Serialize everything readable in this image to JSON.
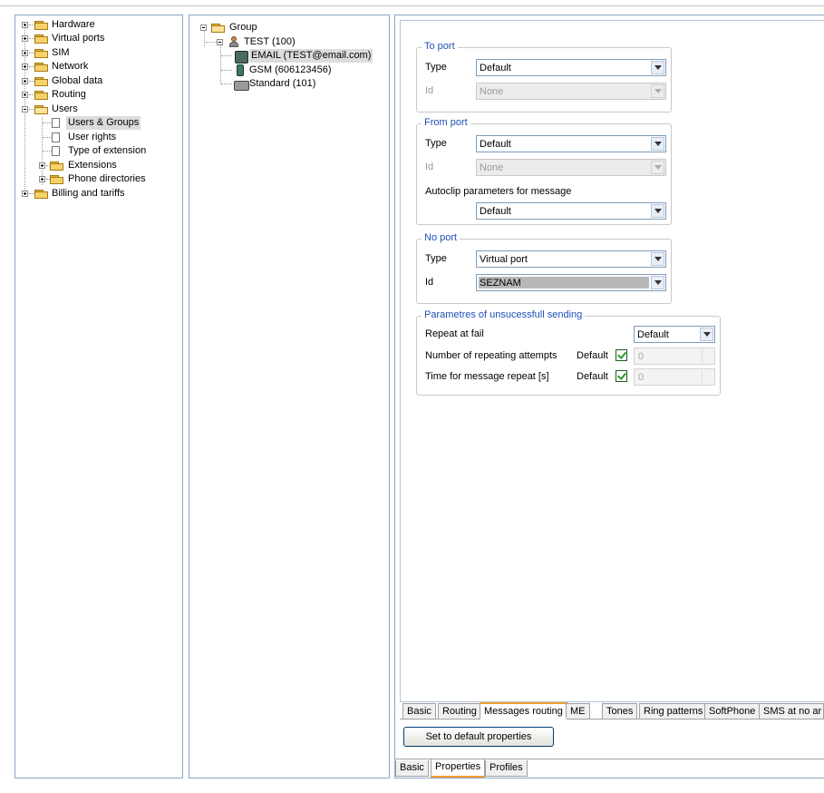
{
  "nav_tree": {
    "items": [
      {
        "label": "Hardware"
      },
      {
        "label": "Virtual ports"
      },
      {
        "label": "SIM"
      },
      {
        "label": "Network"
      },
      {
        "label": "Global data"
      },
      {
        "label": "Routing"
      },
      {
        "label": "Users"
      },
      {
        "label": "Users & Groups"
      },
      {
        "label": "User rights"
      },
      {
        "label": "Type of extension"
      },
      {
        "label": "Extensions"
      },
      {
        "label": "Phone directories"
      },
      {
        "label": "Billing and tariffs"
      }
    ]
  },
  "group_tree": {
    "root": "Group",
    "user": "TEST (100)",
    "email": "EMAIL (TEST@email.com)",
    "gsm": "GSM (606123456)",
    "standard": "Standard (101)"
  },
  "to_port": {
    "title": "To port",
    "type_label": "Type",
    "type_value": "Default",
    "id_label": "Id",
    "id_value": "None"
  },
  "from_port": {
    "title": "From port",
    "type_label": "Type",
    "type_value": "Default",
    "id_label": "Id",
    "id_value": "None",
    "autoclip_label": "Autoclip parameters for message",
    "autoclip_value": "Default"
  },
  "no_port": {
    "title": "No port",
    "type_label": "Type",
    "type_value": "Virtual port",
    "id_label": "Id",
    "id_value": "SEZNAM"
  },
  "unsuccessful": {
    "title": "Parametres of unsucessfull sending",
    "repeat_label": "Repeat at fail",
    "repeat_value": "Default",
    "attempts_label": "Number of repeating attempts",
    "attempts_default": "Default",
    "attempts_value": "0",
    "time_label": "Time for message repeat [s]",
    "time_default": "Default",
    "time_value": "0"
  },
  "inner_tabs": [
    "Basic",
    "Routing",
    "Messages routing",
    "ME",
    "Tones",
    "Ring patterns",
    "SoftPhone",
    "SMS at no ar"
  ],
  "default_button": "Set to default properties",
  "outer_tabs": [
    "Basic",
    "Properties",
    "Profiles"
  ],
  "colors": {
    "legend": "#1f4fb5",
    "pane_border": "#8aa6c8",
    "active_tab_accent": "#f0a030"
  }
}
